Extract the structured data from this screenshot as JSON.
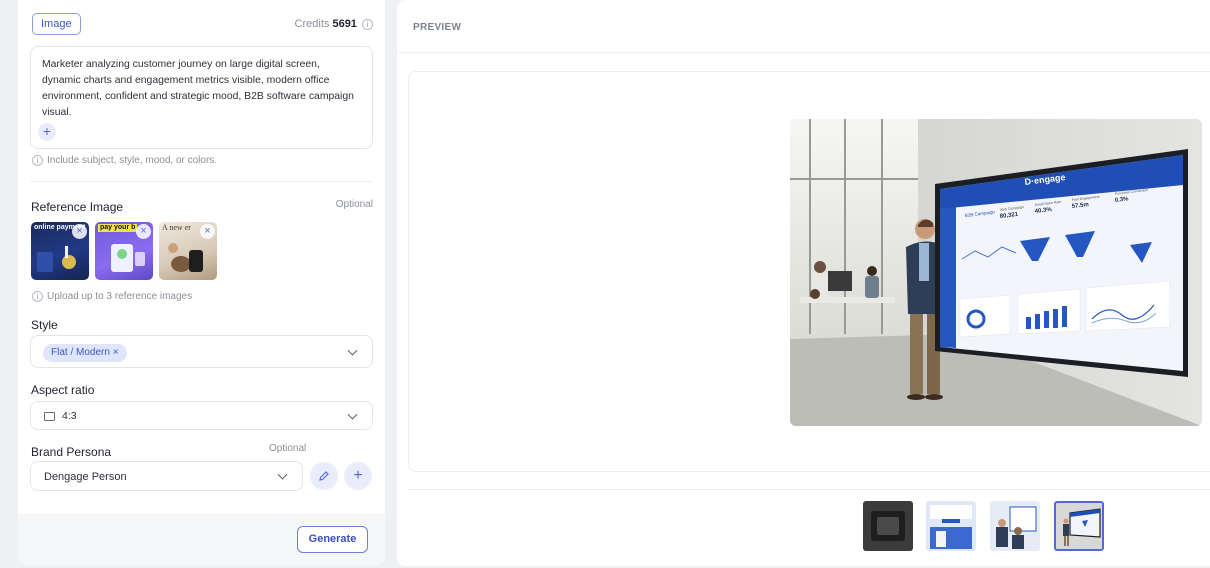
{
  "left_panel": {
    "type_chip": "Image",
    "credits_label": "Credits",
    "credits_value": "5691",
    "prompt_text": "Marketer analyzing customer journey on large digital screen, dynamic charts and engagement metrics visible, modern office environment, confident and strategic mood, B2B software campaign visual.",
    "prompt_hint": "Include subject, style, mood, or colors.",
    "reference": {
      "title": "Reference Image",
      "optional": "Optional",
      "hint": "Upload up to 3 reference images",
      "thumbs": [
        {
          "text": "online payment"
        },
        {
          "text": "pay your b"
        },
        {
          "text": "A new er"
        }
      ]
    },
    "style": {
      "title": "Style",
      "selected": "Flat / Modern"
    },
    "aspect": {
      "title": "Aspect ratio",
      "value": "4:3"
    },
    "persona": {
      "title": "Brand Persona",
      "optional": "Optional",
      "value": "Dengage Person"
    },
    "generate_label": "Generate"
  },
  "preview": {
    "label": "PREVIEW",
    "screen_logo": "D·engage",
    "screen_title": "B2B Campaign",
    "screen_stats": [
      {
        "label": "Web Campaign",
        "value": "80,321"
      },
      {
        "label": "Email Open Rate",
        "value": "40.3%"
      },
      {
        "label": "Paid Engagement",
        "value": "57.5m"
      },
      {
        "label": "Purchase Conversion",
        "value": "0.3%"
      }
    ]
  },
  "colors": {
    "accent": "#3a56c4",
    "screen_blue": "#1f4fb5"
  }
}
